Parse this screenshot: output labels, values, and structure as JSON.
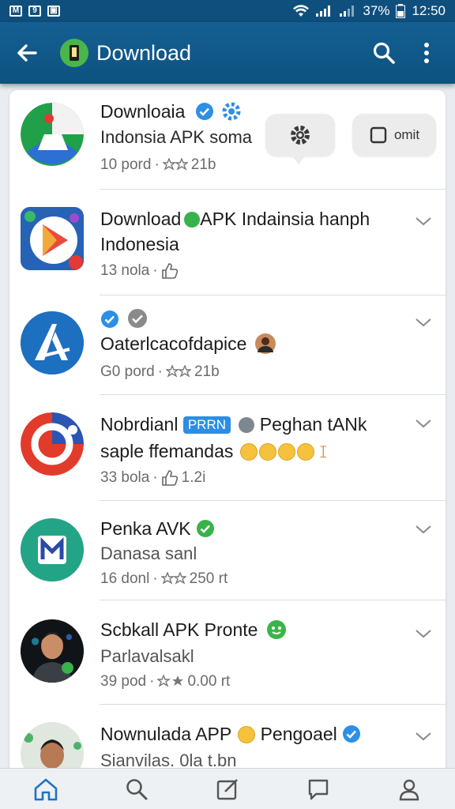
{
  "status_bar": {
    "time": "12:50",
    "battery": "37%"
  },
  "app_bar": {
    "title": "Download"
  },
  "popup": {
    "second_label": "omit"
  },
  "items": [
    {
      "line1": "Downloaia",
      "line2": "Indonsia APK soma",
      "meta_count": "10 pord",
      "meta_extra": "21b"
    },
    {
      "line1": "Download",
      "line1_b": "APK Indainsia hanph",
      "line2": "Indonesia",
      "meta_count": "13 nola"
    },
    {
      "line2": "Oaterlcacofdapice",
      "meta_count": "G0 pord",
      "meta_extra": "21b"
    },
    {
      "line1": "Nobrdianl",
      "badge": "PRRN",
      "line1_b": "Peghan tANk",
      "line2": "saple ffemandas",
      "meta_count": "33 bola",
      "meta_extra": "1.2i"
    },
    {
      "line1": "Penka AVK",
      "line2": "Danasa sanl",
      "meta_count": "16 donl",
      "meta_extra": "250 rt"
    },
    {
      "line1": "Scbkall APK Pronte",
      "line2": "Parlavalsakl",
      "meta_count": "39 pod",
      "meta_extra": "0.00 rt"
    },
    {
      "line1": "Nownulada APP",
      "line1_b": "Pengoael",
      "line2": "Sianvilas. 0la t.bn"
    }
  ],
  "colors": {
    "app_bar": "#0f5a8c",
    "accent": "#1e73c8",
    "verified": "#2d8fe6",
    "green": "#38b24a"
  },
  "icons": {
    "app_bar": [
      "back-arrow-icon",
      "app-logo-icon",
      "search-icon",
      "more-vert-icon"
    ],
    "bottom_nav": [
      "home-icon",
      "search-icon",
      "compose-icon",
      "chat-icon",
      "profile-icon"
    ]
  }
}
